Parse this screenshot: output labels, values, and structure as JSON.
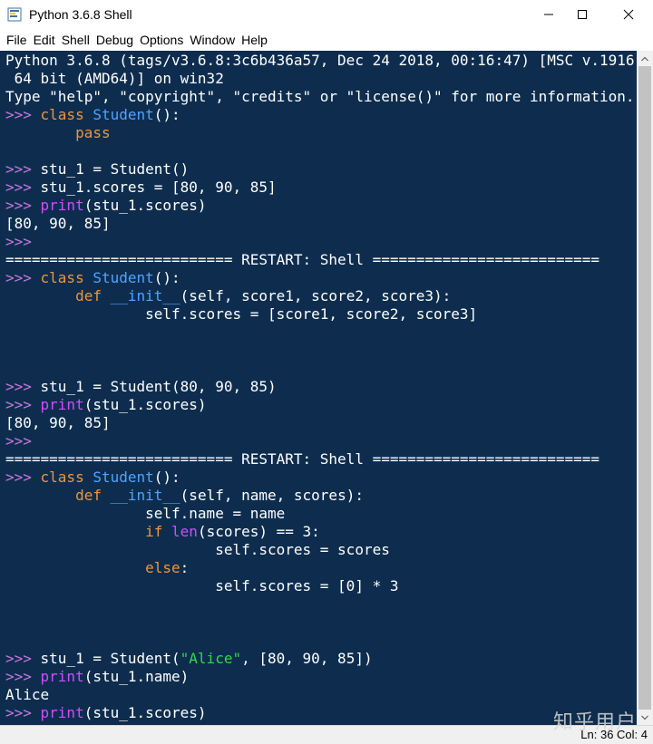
{
  "window": {
    "title": "Python 3.6.8 Shell",
    "minimize_glyph": "—",
    "maximize_glyph": "☐",
    "close_glyph": "✕"
  },
  "menu": {
    "file": "File",
    "edit": "Edit",
    "shell": "Shell",
    "debug": "Debug",
    "options": "Options",
    "window": "Window",
    "help": "Help"
  },
  "shell": {
    "banner1": "Python 3.6.8 (tags/v3.6.8:3c6b436a57, Dec 24 2018, 00:16:47) [MSC v.1916",
    "banner2": " 64 bit (AMD64)] on win32",
    "banner3": "Type \"help\", \"copyright\", \"credits\" or \"license()\" for more information.",
    "prompt": ">>> ",
    "kw_class": "class",
    "kw_pass": "pass",
    "kw_def": "def",
    "kw_if": "if",
    "kw_else": "else",
    "student": "Student",
    "init": "__init__",
    "print": "print",
    "len": "len",
    "paren_colon": "():",
    "stu_assign_empty": "stu_1 = Student()",
    "stu_scores_assign": "stu_1.scores = [80, 90, 85]",
    "stu_scores_arg": "(stu_1.scores)",
    "stu_name_arg": "(stu_1.name)",
    "output_list": "[80, 90, 85]",
    "output_alice": "Alice",
    "prompt_bare": ">>>",
    "restart": "========================== RESTART: Shell ==========================",
    "init1_args": "(self, score1, score2, score3):",
    "init1_body": "self.scores = [score1, score2, score3]",
    "stu_assign_nums": "stu_1 = Student(80, 90, 85)",
    "init2_args": "(self, name, scores):",
    "init2_name": "self.name = name",
    "len_args": "(scores) == 3:",
    "init2_scores": "self.scores = scores",
    "else_colon": ":",
    "init2_zero": "self.scores = [0] * 3",
    "stu_assign_pre": "stu_1 = Student(",
    "alice_str": "\"Alice\"",
    "stu_assign_post": ", [80, 90, 85])"
  },
  "status": {
    "position": "Ln: 36  Col: 4"
  },
  "watermark": "知乎用户",
  "colors": {
    "background": "#0e2d4e",
    "prompt": "#c678dd",
    "keyword": "#f0943c",
    "definition": "#4fa4ff",
    "builtin": "#d04cff",
    "string": "#2fd84a"
  }
}
